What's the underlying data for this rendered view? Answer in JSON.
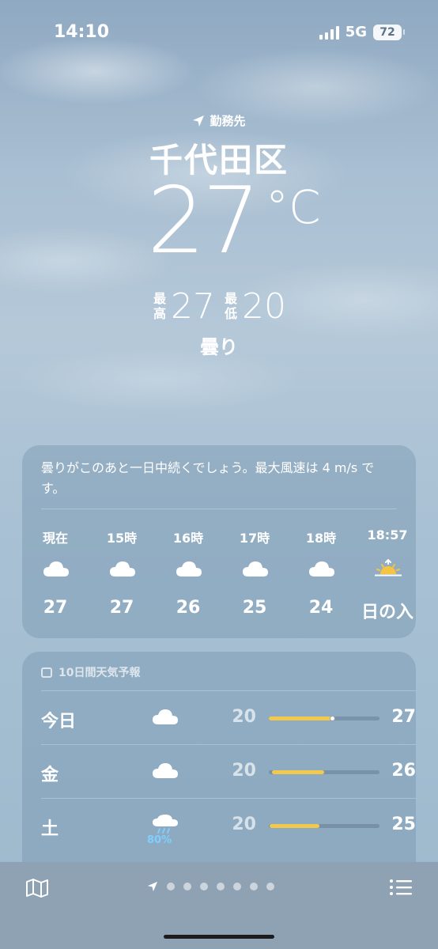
{
  "status": {
    "time": "14:10",
    "network": "5G",
    "battery": "72"
  },
  "hero": {
    "location_tag": "勤務先",
    "city": "千代田区",
    "temperature": "27",
    "unit": "°C",
    "high_label": "最高",
    "high": "27",
    "low_label": "最低",
    "low": "20",
    "condition": "曇り"
  },
  "hourly": {
    "summary": "曇りがこのあと一日中続くでしょう。最大風速は 4 m/s です。",
    "items": [
      {
        "label": "現在",
        "icon": "cloud-icon",
        "temp": "27"
      },
      {
        "label": "15時",
        "icon": "cloud-icon",
        "temp": "27"
      },
      {
        "label": "16時",
        "icon": "cloud-icon",
        "temp": "26"
      },
      {
        "label": "17時",
        "icon": "cloud-icon",
        "temp": "25"
      },
      {
        "label": "18時",
        "icon": "cloud-icon",
        "temp": "24"
      },
      {
        "label": "18:57",
        "icon": "sunset-icon",
        "temp": "日の入"
      }
    ]
  },
  "daily": {
    "header": "10日間天気予報",
    "days": [
      {
        "name": "今日",
        "icon": "cloud-icon",
        "low": "20",
        "high": "27",
        "range_start": 0.0,
        "range_end": 0.57,
        "current": 0.57
      },
      {
        "name": "金",
        "icon": "cloud-icon",
        "low": "20",
        "high": "26",
        "range_start": 0.03,
        "range_end": 0.5
      },
      {
        "name": "土",
        "icon": "cloud-rain-icon",
        "precip": "80%",
        "low": "20",
        "high": "25",
        "range_start": 0.01,
        "range_end": 0.46
      }
    ]
  },
  "colors": {
    "bar_fill": "#f2c94c",
    "precip": "#7fd0ff"
  }
}
